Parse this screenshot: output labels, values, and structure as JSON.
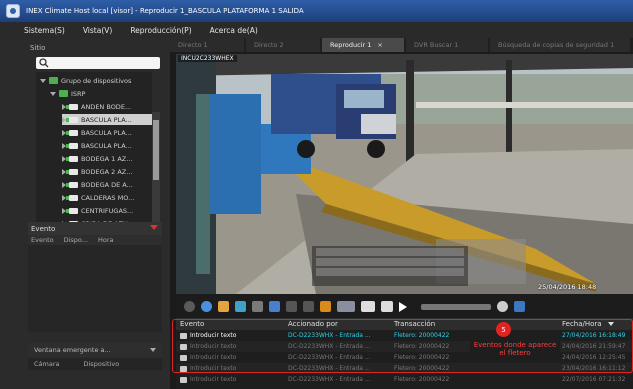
{
  "window": {
    "title": "INEX Climate Host local [visor] - Reproducir 1_BASCULA PLATAFORMA 1 SALIDA"
  },
  "menu": [
    "Sistema(S)",
    "Vista(V)",
    "Reproducción(P)",
    "Acerca de(A)"
  ],
  "sidebar": {
    "site_label": "Sitio",
    "search_placeholder": "",
    "tree": [
      {
        "label": "Grupo de dispositivos",
        "kind": "folder",
        "level": 0,
        "expanded": true
      },
      {
        "label": "ISRP",
        "kind": "folder",
        "level": 1,
        "expanded": true
      },
      {
        "label": "ANDEN BODE...",
        "kind": "camera",
        "level": 2
      },
      {
        "label": "BASCULA PLA...",
        "kind": "camera",
        "level": 2,
        "selected": true
      },
      {
        "label": "BASCULA PLA...",
        "kind": "camera",
        "level": 2
      },
      {
        "label": "BASCULA PLA...",
        "kind": "camera",
        "level": 2
      },
      {
        "label": "BODEGA 1 AZ...",
        "kind": "camera",
        "level": 2
      },
      {
        "label": "BODEGA 2 AZ...",
        "kind": "camera",
        "level": 2
      },
      {
        "label": "BODEGA DE A...",
        "kind": "camera",
        "level": 2
      },
      {
        "label": "CALDERAS MO...",
        "kind": "camera",
        "level": 2
      },
      {
        "label": "CENTRIFUGAS...",
        "kind": "camera",
        "level": 2
      },
      {
        "label": "CRIBA DE AZU...",
        "kind": "camera",
        "level": 2
      }
    ],
    "event_panel": {
      "title": "Evento",
      "columns": [
        "Evento",
        "Dispo...",
        "Hora"
      ]
    },
    "popup": {
      "label": "Ventana emergente a..."
    },
    "device_cols": [
      "Cámara",
      "Dispositivo"
    ]
  },
  "tabs": [
    {
      "label": "Directo 1",
      "active": false
    },
    {
      "label": "Directo 2",
      "active": false
    },
    {
      "label": "Reproducir 1",
      "active": true,
      "closable": true
    },
    {
      "label": "DVR Buscar 1",
      "active": false
    },
    {
      "label": "Búsqueda de copias de seguridad 1",
      "active": false
    }
  ],
  "video": {
    "camera_label": "INCU2C233WHEX",
    "timestamp": "25/04/2016 18:48"
  },
  "event_table": {
    "columns": [
      "Evento",
      "Accionado por",
      "Transacción",
      "Fecha/Hora"
    ],
    "rows": [
      {
        "event": "Introducir texto",
        "by": "DC-D2233WHX - Entrada ...",
        "transaction": "Fletero: 20000422",
        "datetime": "27/04/2016 16:18:49",
        "highlight": true
      },
      {
        "event": "Introducir texto",
        "by": "DC-D2233WHX - Entrada ...",
        "transaction": "Fletero: 20000422",
        "datetime": "24/04/2016 21:59:47",
        "highlight": false
      },
      {
        "event": "Introducir texto",
        "by": "DC-D2233WHX - Entrada ...",
        "transaction": "Fletero: 20000422",
        "datetime": "24/04/2016 12:25:45",
        "highlight": false
      },
      {
        "event": "Introducir texto",
        "by": "DC-D2233WHX - Entrada ...",
        "transaction": "Fletero: 20000422",
        "datetime": "23/04/2016 16:11:12",
        "highlight": false
      },
      {
        "event": "Introducir texto",
        "by": "DC-D2233WHX - Entrada ...",
        "transaction": "Fletero: 20000422",
        "datetime": "22/07/2016 07:21:32",
        "highlight": false
      }
    ]
  },
  "annotation": {
    "badge": "5",
    "text": "Eventos donde aparece el fletero"
  },
  "colors": {
    "accent_cyan": "#2ed3e8",
    "annotation_red": "#e02424",
    "titlebar_blue": "#2f5fa8"
  }
}
